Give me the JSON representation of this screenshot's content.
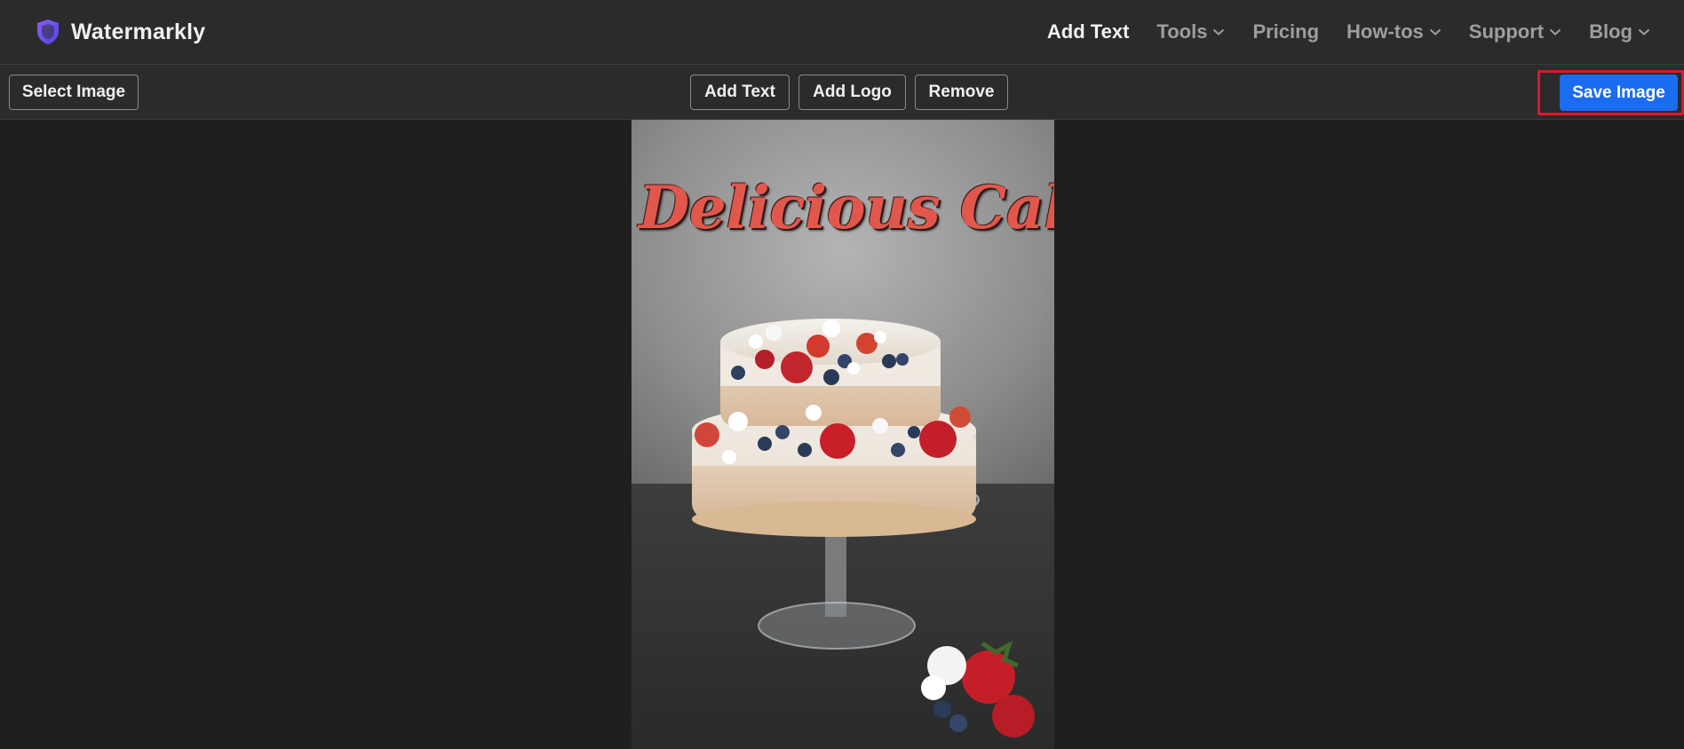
{
  "app": {
    "brand_name": "Watermarkly",
    "brand_icon": "shield-icon",
    "accent_color": "#1a6cf0",
    "highlight_color": "#e0162b"
  },
  "nav": {
    "items": [
      {
        "label": "Add Text",
        "active": true,
        "dropdown": false
      },
      {
        "label": "Tools",
        "active": false,
        "dropdown": true
      },
      {
        "label": "Pricing",
        "active": false,
        "dropdown": false
      },
      {
        "label": "How-tos",
        "active": false,
        "dropdown": true
      },
      {
        "label": "Support",
        "active": false,
        "dropdown": true
      },
      {
        "label": "Blog",
        "active": false,
        "dropdown": true
      }
    ]
  },
  "toolbar": {
    "select_image": "Select Image",
    "add_text": "Add Text",
    "add_logo": "Add Logo",
    "remove": "Remove",
    "save_image": "Save Image"
  },
  "canvas": {
    "watermark_text": "Delicious Cake",
    "watermark_color": "#e2574c"
  }
}
